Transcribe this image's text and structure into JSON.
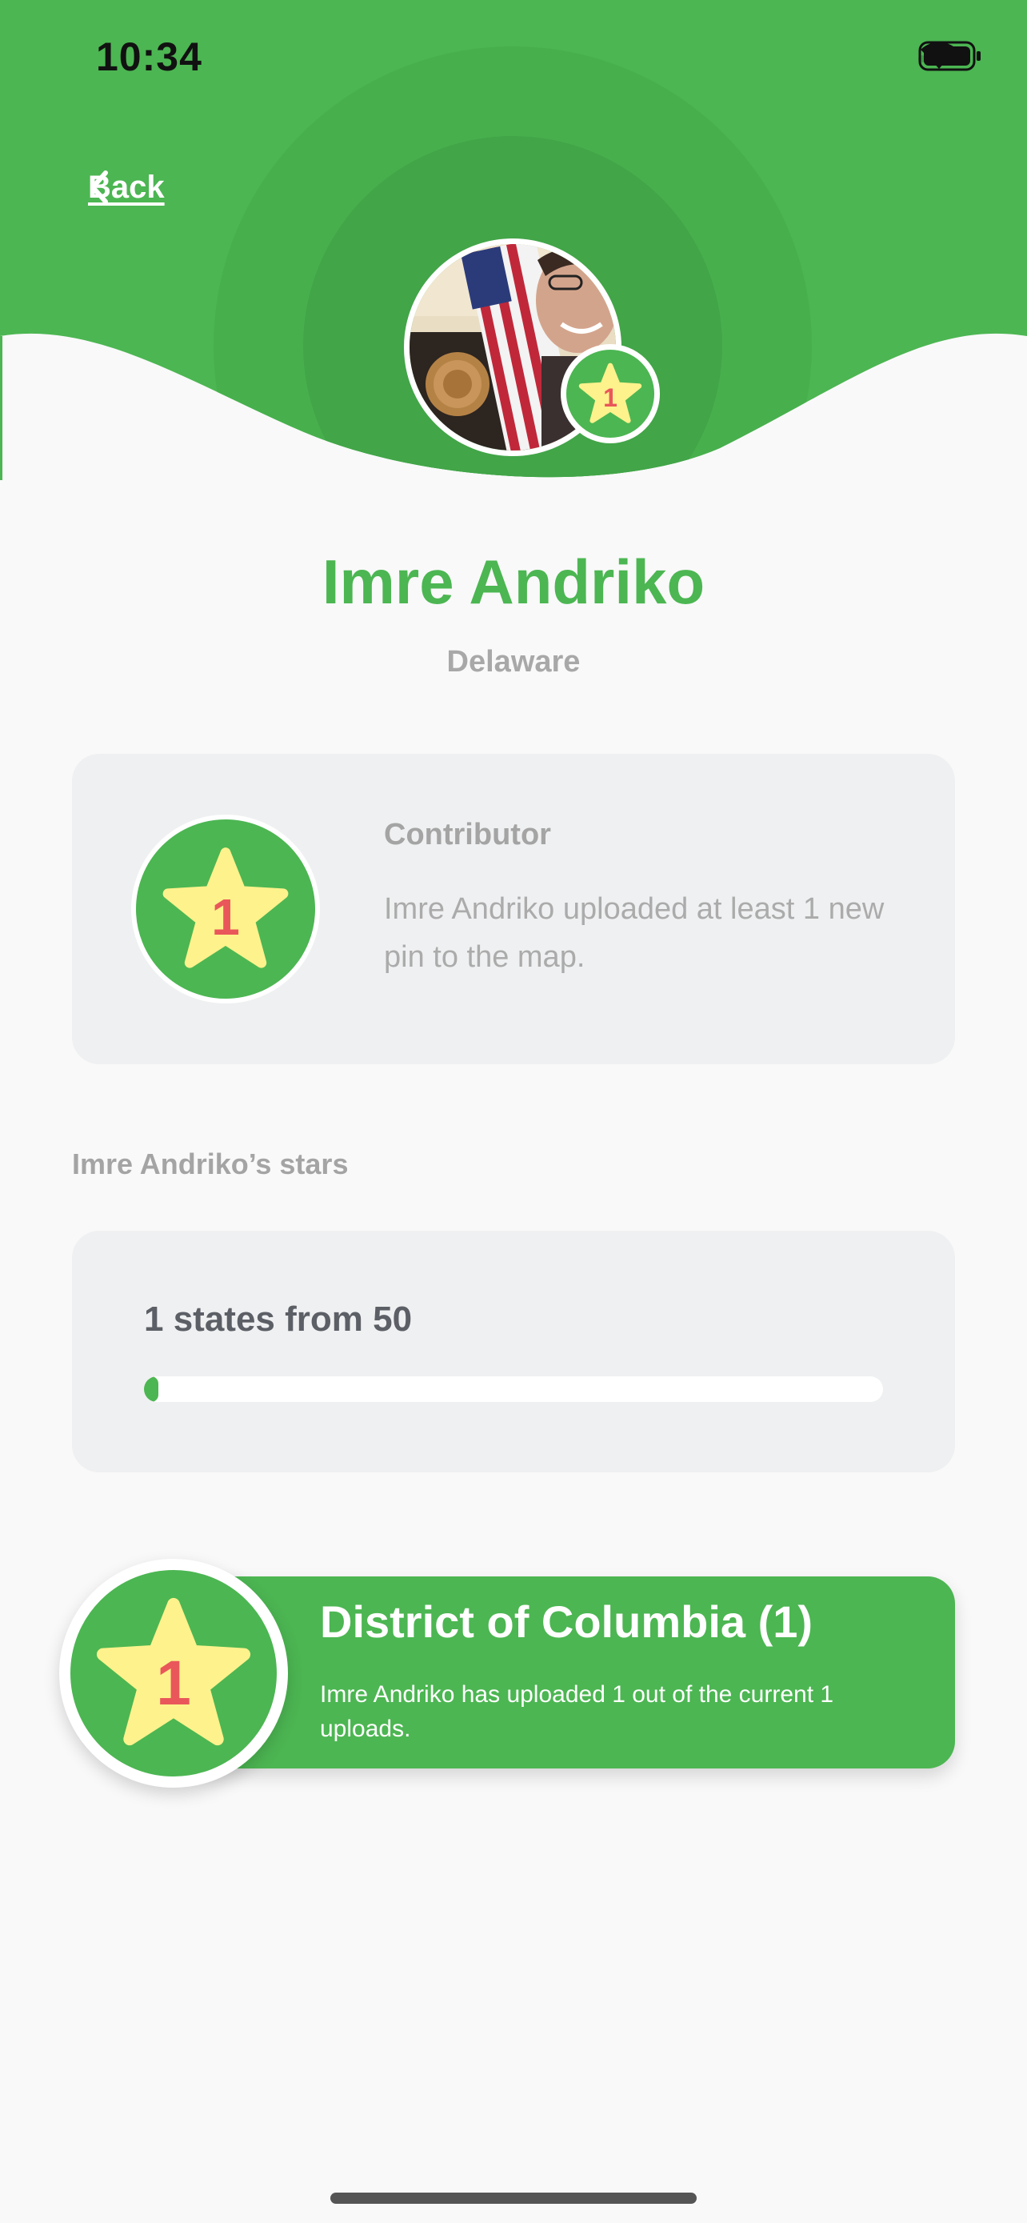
{
  "status_bar": {
    "time": "10:34"
  },
  "nav": {
    "back_label": "Back"
  },
  "profile": {
    "name": "Imre Andriko",
    "state": "Delaware",
    "avatar_badge_number": "1"
  },
  "achievement": {
    "badge_number": "1",
    "title": "Contributor",
    "description": "Imre Andriko uploaded at least 1 new pin to the map."
  },
  "stars_section": {
    "label": "Imre Andriko’s stars"
  },
  "progress": {
    "text": "1 states from 50",
    "current": 1,
    "total": 50
  },
  "state_list": [
    {
      "badge_number": "1",
      "title": "District of Columbia (1)",
      "description": "Imre Andriko has uploaded 1 out of the current 1 uploads."
    }
  ],
  "colors": {
    "brand_green": "#4cb652",
    "header_ring": "#44a84a",
    "star_yellow": "#fdf28c",
    "star_number_red": "#e9575a",
    "card_bg": "#eff0f1"
  },
  "icons": {
    "back": "chevron-left-icon",
    "wifi": "wifi-icon",
    "battery": "battery-icon",
    "badge": "star-icon"
  }
}
